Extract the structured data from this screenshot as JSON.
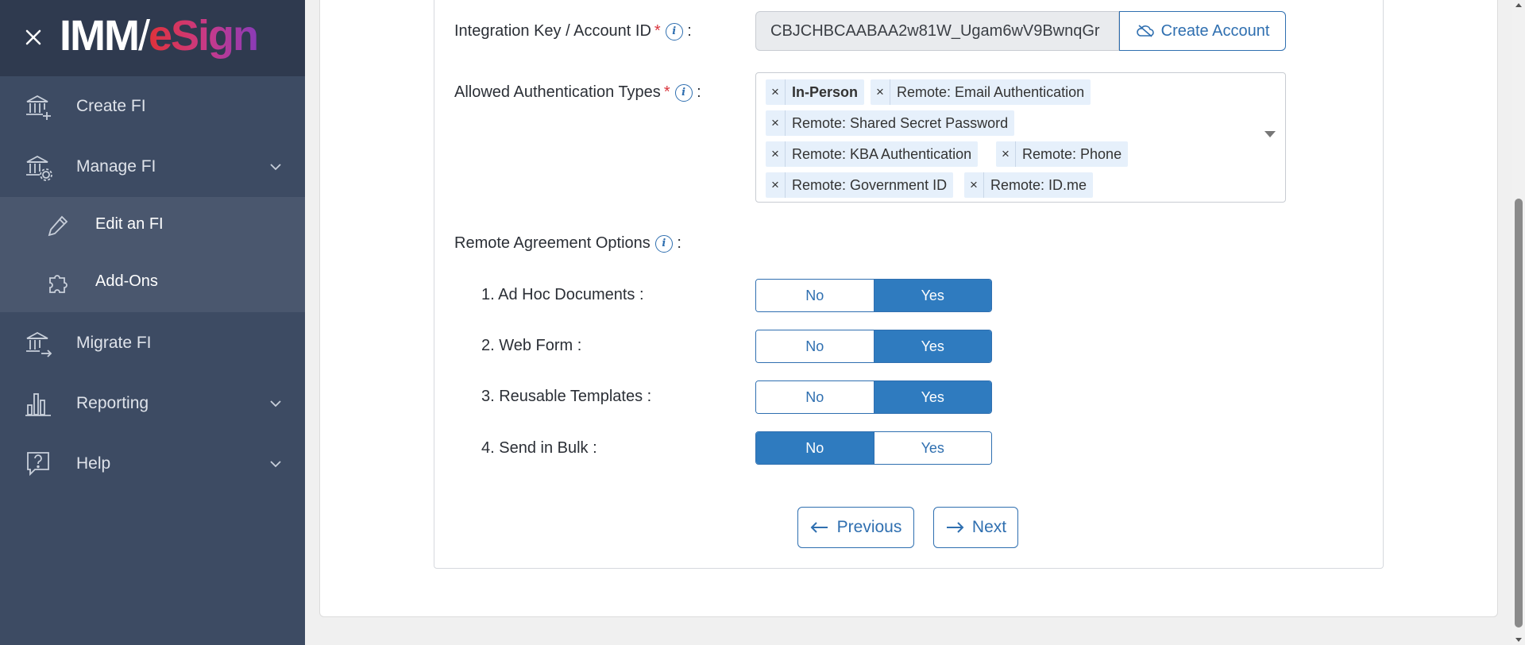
{
  "sidebar": {
    "logo_left": "IMM",
    "logo_slash": "/",
    "logo_right": "eSign",
    "items": [
      {
        "label": "Create FI"
      },
      {
        "label": "Manage FI"
      },
      {
        "label": "Edit an FI"
      },
      {
        "label": "Add-Ons"
      },
      {
        "label": "Migrate FI"
      },
      {
        "label": "Reporting"
      },
      {
        "label": "Help"
      }
    ]
  },
  "form": {
    "integration_label": "Integration Key / Account ID",
    "required_mark": "*",
    "colon": ":",
    "integration_value": "CBJCHBCAABAA2w81W_Ugam6wV9BwnqGr",
    "create_account_label": "Create Account",
    "auth_label": "Allowed Authentication Types",
    "auth_tags": [
      "In-Person",
      "Remote: Email Authentication",
      "Remote: Shared Secret Password",
      "Remote: KBA Authentication",
      "Remote: Phone",
      "Remote: Government ID",
      "Remote: ID.me"
    ],
    "remote_label": "Remote Agreement Options",
    "options": [
      {
        "label": "1. Ad Hoc Documents :",
        "selected": "Yes"
      },
      {
        "label": "2. Web Form :",
        "selected": "Yes"
      },
      {
        "label": "3. Reusable Templates :",
        "selected": "Yes"
      },
      {
        "label": "4. Send in Bulk :",
        "selected": "No"
      }
    ],
    "no_label": "No",
    "yes_label": "Yes",
    "previous_label": "Previous",
    "next_label": "Next"
  },
  "colors": {
    "sidebar_bg": "#3d4b63",
    "accent": "#2f7bbf",
    "required": "#d9363e"
  }
}
